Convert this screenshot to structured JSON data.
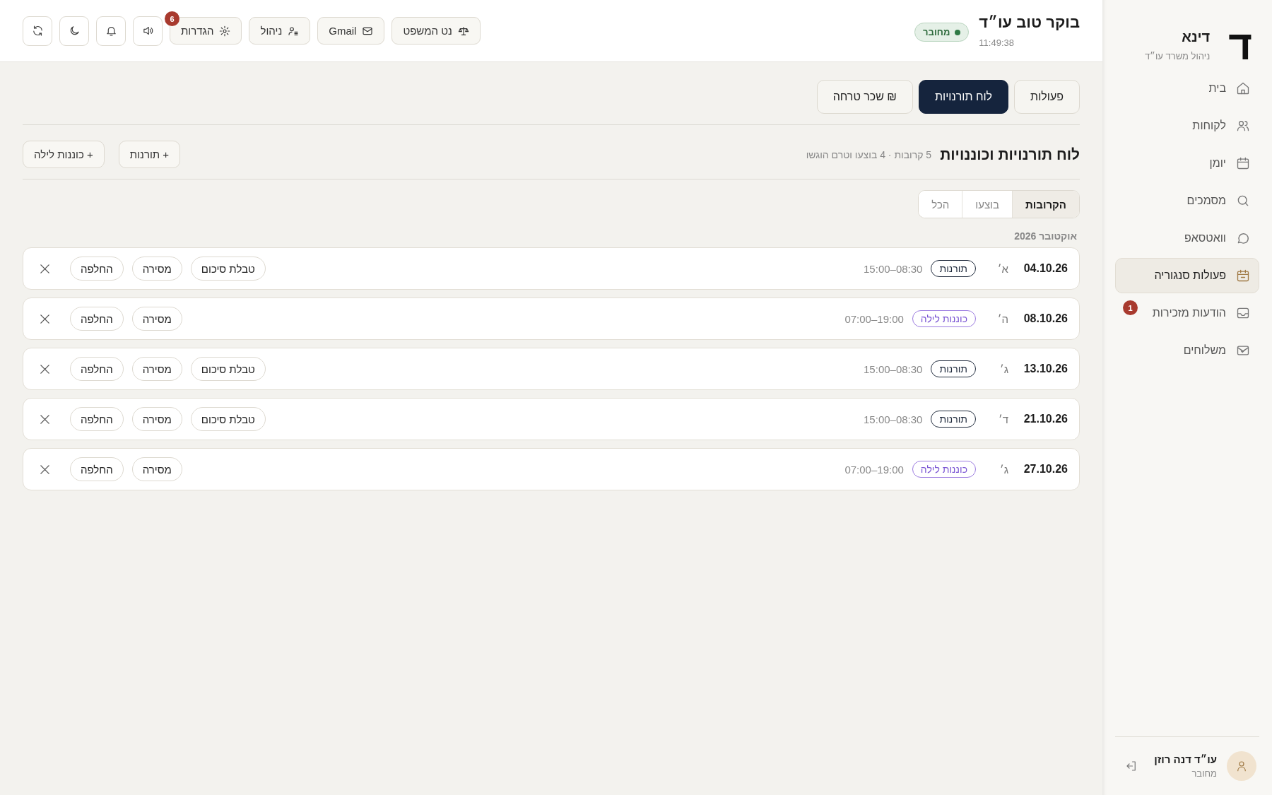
{
  "sidebar": {
    "logo": "ד",
    "brand": "דינא",
    "subtitle": "ניהול משרד עו״ד",
    "items": [
      {
        "label": "בית",
        "selected": false
      },
      {
        "label": "לקוחות",
        "selected": false
      },
      {
        "label": "יומן",
        "selected": false
      },
      {
        "label": "מסמכים",
        "selected": false
      },
      {
        "label": "וואטסאפ",
        "selected": false
      },
      {
        "label": "פעולות סנגוריה",
        "selected": true
      },
      {
        "label": "הודעות מזכירות",
        "selected": false,
        "badge": "1"
      },
      {
        "label": "משלוחים",
        "selected": false
      }
    ],
    "user": {
      "name": "עו״ד דנה רוזן",
      "status": "מחובר"
    }
  },
  "header": {
    "greeting": "בוקר טוב עו״ד",
    "time": "11:49:38",
    "connection": "מחובר",
    "buttons": [
      {
        "label": "נט המשפט"
      },
      {
        "label": "Gmail"
      },
      {
        "label": "ניהול"
      },
      {
        "label": "הגדרות",
        "badge": "6"
      }
    ]
  },
  "tabs": [
    {
      "label": "פעולות",
      "selected": false
    },
    {
      "label": "לוח תורנויות",
      "selected": true
    },
    {
      "label": "₪ שכר טרחה",
      "selected": false
    }
  ],
  "section": {
    "title": "לוח תורנויות וכוננויות",
    "summary": "5 קרובות · 4 בוצעו וטרם הוגשו",
    "add_buttons": [
      "+ תורנות",
      "+ כוננות לילה"
    ]
  },
  "filters": [
    {
      "label": "הקרובות",
      "selected": true
    },
    {
      "label": "בוצעו",
      "selected": false
    },
    {
      "label": "הכל",
      "selected": false
    }
  ],
  "month": "אוקטובר 2026",
  "rows": [
    {
      "date": "04.10.26",
      "day": "א׳",
      "tag": "תורנות",
      "kind": "shift",
      "hours": "15:00–08:30",
      "actions": [
        "טבלת סיכום",
        "מסירה",
        "החלפה"
      ]
    },
    {
      "date": "08.10.26",
      "day": "ה׳",
      "tag": "כוננות לילה",
      "kind": "night",
      "hours": "07:00–19:00",
      "actions": [
        "מסירה",
        "החלפה"
      ]
    },
    {
      "date": "13.10.26",
      "day": "ג׳",
      "tag": "תורנות",
      "kind": "shift",
      "hours": "15:00–08:30",
      "actions": [
        "טבלת סיכום",
        "מסירה",
        "החלפה"
      ]
    },
    {
      "date": "21.10.26",
      "day": "ד׳",
      "tag": "תורנות",
      "kind": "shift",
      "hours": "15:00–08:30",
      "actions": [
        "טבלת סיכום",
        "מסירה",
        "החלפה"
      ]
    },
    {
      "date": "27.10.26",
      "day": "ג׳",
      "tag": "כוננות לילה",
      "kind": "night",
      "hours": "07:00–19:00",
      "actions": [
        "מסירה",
        "החלפה"
      ]
    }
  ]
}
